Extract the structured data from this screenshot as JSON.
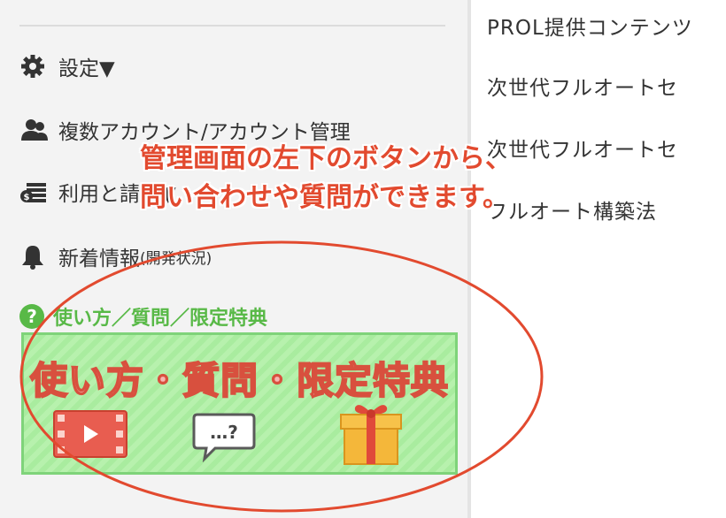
{
  "sidebar": {
    "items": [
      {
        "label": "設定▼",
        "icon": "gear-icon"
      },
      {
        "label": "複数アカウント/アカウント管理",
        "icon": "users-icon"
      },
      {
        "label": "利用と請求▼",
        "icon": "billing-icon"
      },
      {
        "label": "新着情報",
        "sub_label": "(開発状況)",
        "icon": "bell-icon"
      }
    ],
    "help": {
      "label": "使い方／質問／限定特典",
      "icon": "question-circle-icon"
    },
    "banner": {
      "title": "使い方・質問・限定特典",
      "chat_icon_text": "…?",
      "icons": [
        "video-play-icon",
        "chat-bubble-icon",
        "gift-box-icon"
      ]
    }
  },
  "main": {
    "items": [
      {
        "label": "PROL提供コンテンツ"
      },
      {
        "label": "次世代フルオートセ"
      },
      {
        "label": "次世代フルオートセ"
      },
      {
        "label": "フルオート構築法"
      }
    ]
  },
  "annotation": {
    "line1": "管理画面の左下のボタンから、",
    "line2": "問い合わせや質問ができます。",
    "color": "#e24a2f"
  }
}
